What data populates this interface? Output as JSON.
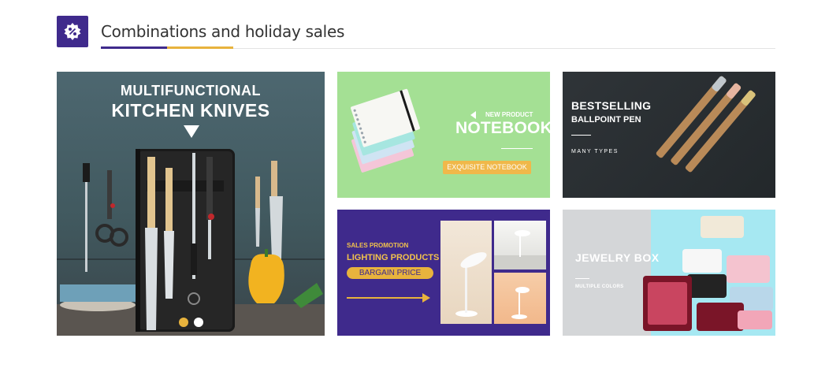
{
  "header": {
    "icon": "discount-percent-icon",
    "title": "Combinations and holiday sales"
  },
  "banners": {
    "knives": {
      "line1": "MULTIFUNCTIONAL",
      "line2": "KITCHEN KNIVES"
    },
    "notebook": {
      "tag_small": "NEW PRODUCT",
      "title": "NOTEBOOK",
      "label": "EXQUISITE NOTEBOOK"
    },
    "pen": {
      "line1": "BESTSELLING",
      "line2": "BALLPOINT PEN",
      "line3": "MANY TYPES"
    },
    "lighting": {
      "line1": "SALES PROMOTION",
      "line2": "LIGHTING PRODUCTS",
      "button": "BARGAIN PRICE"
    },
    "jewelry": {
      "line1": "JEWELRY BOX",
      "line2": "MULTIPLE COLORS"
    }
  },
  "carousel": {
    "active_index": 0,
    "count": 2
  },
  "colors": {
    "brand_purple": "#3f2a8c",
    "accent_gold": "#e8b33d",
    "notebook_green": "#a4e094"
  }
}
